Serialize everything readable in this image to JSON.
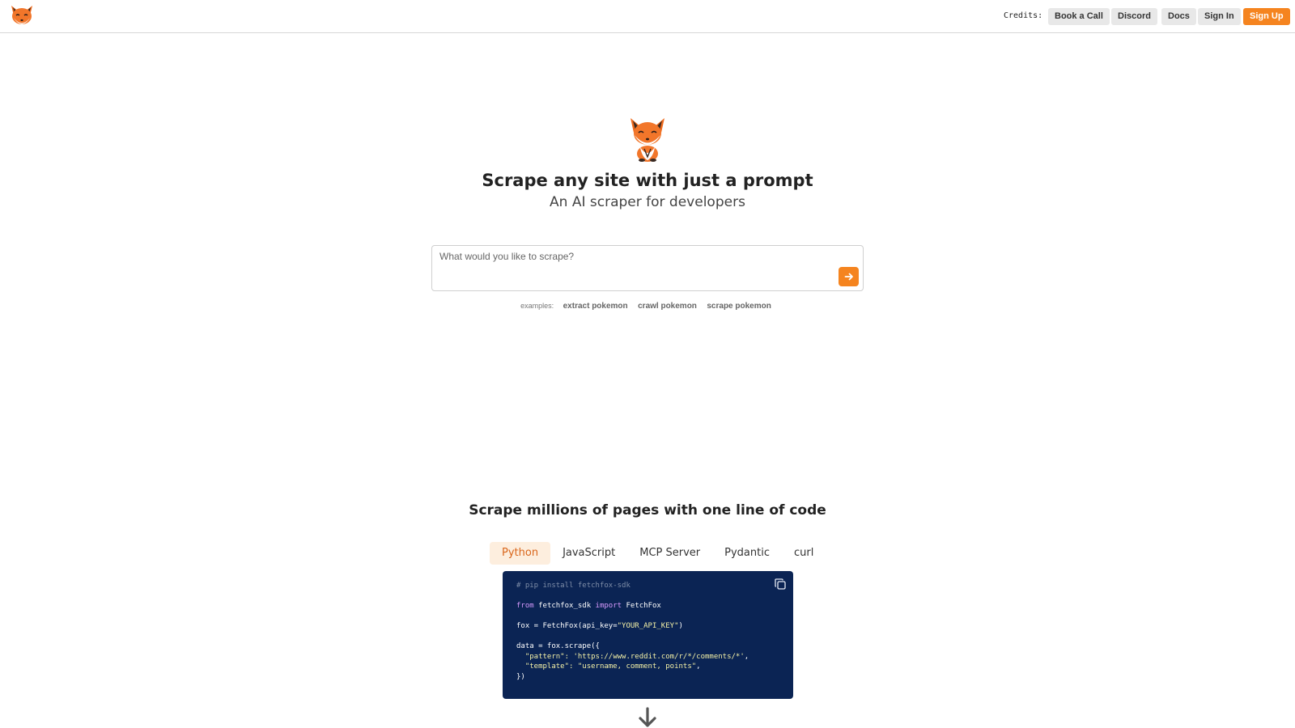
{
  "header": {
    "credits_label": "Credits:",
    "nav": {
      "book_call": "Book a Call",
      "discord": "Discord",
      "docs": "Docs",
      "sign_in": "Sign In",
      "sign_up": "Sign Up"
    }
  },
  "hero": {
    "title": "Scrape any site with just a prompt",
    "subtitle": "An AI scraper for developers",
    "prompt_placeholder": "What would you like to scrape?",
    "examples_label": "examples:",
    "examples": [
      "extract pokemon",
      "crawl pokemon",
      "scrape pokemon"
    ]
  },
  "code_section": {
    "title": "Scrape millions of pages with one line of code",
    "tabs": [
      "Python",
      "JavaScript",
      "MCP Server",
      "Pydantic",
      "curl"
    ],
    "active_tab": "Python",
    "code": {
      "comment": "# pip install fetchfox-sdk",
      "import_from": "from",
      "import_module": " fetchfox_sdk ",
      "import_kw": "import",
      "import_name": " FetchFox",
      "fox_prefix": "fox = FetchFox(api_key=",
      "fox_key": "\"YOUR_API_KEY\"",
      "fox_suffix": ")",
      "data_line": "data = fox.scrape({",
      "pattern_key": "  \"pattern\": ",
      "pattern_val": "'https://www.reddit.com/r/*/comments/*'",
      "pattern_end": ",",
      "template_key": "  \"template\": ",
      "template_val": "\"username, comment, points\"",
      "template_end": ",",
      "close_line": "})"
    }
  },
  "colors": {
    "accent": "#f5841f",
    "code_bg": "#0b2454",
    "active_tab_bg": "#fdeede",
    "active_tab_text": "#d9651a"
  },
  "icons": {
    "logo": "fox-logo-icon",
    "submit": "arrow-right-icon",
    "copy": "copy-icon",
    "scroll": "arrow-down-icon"
  }
}
